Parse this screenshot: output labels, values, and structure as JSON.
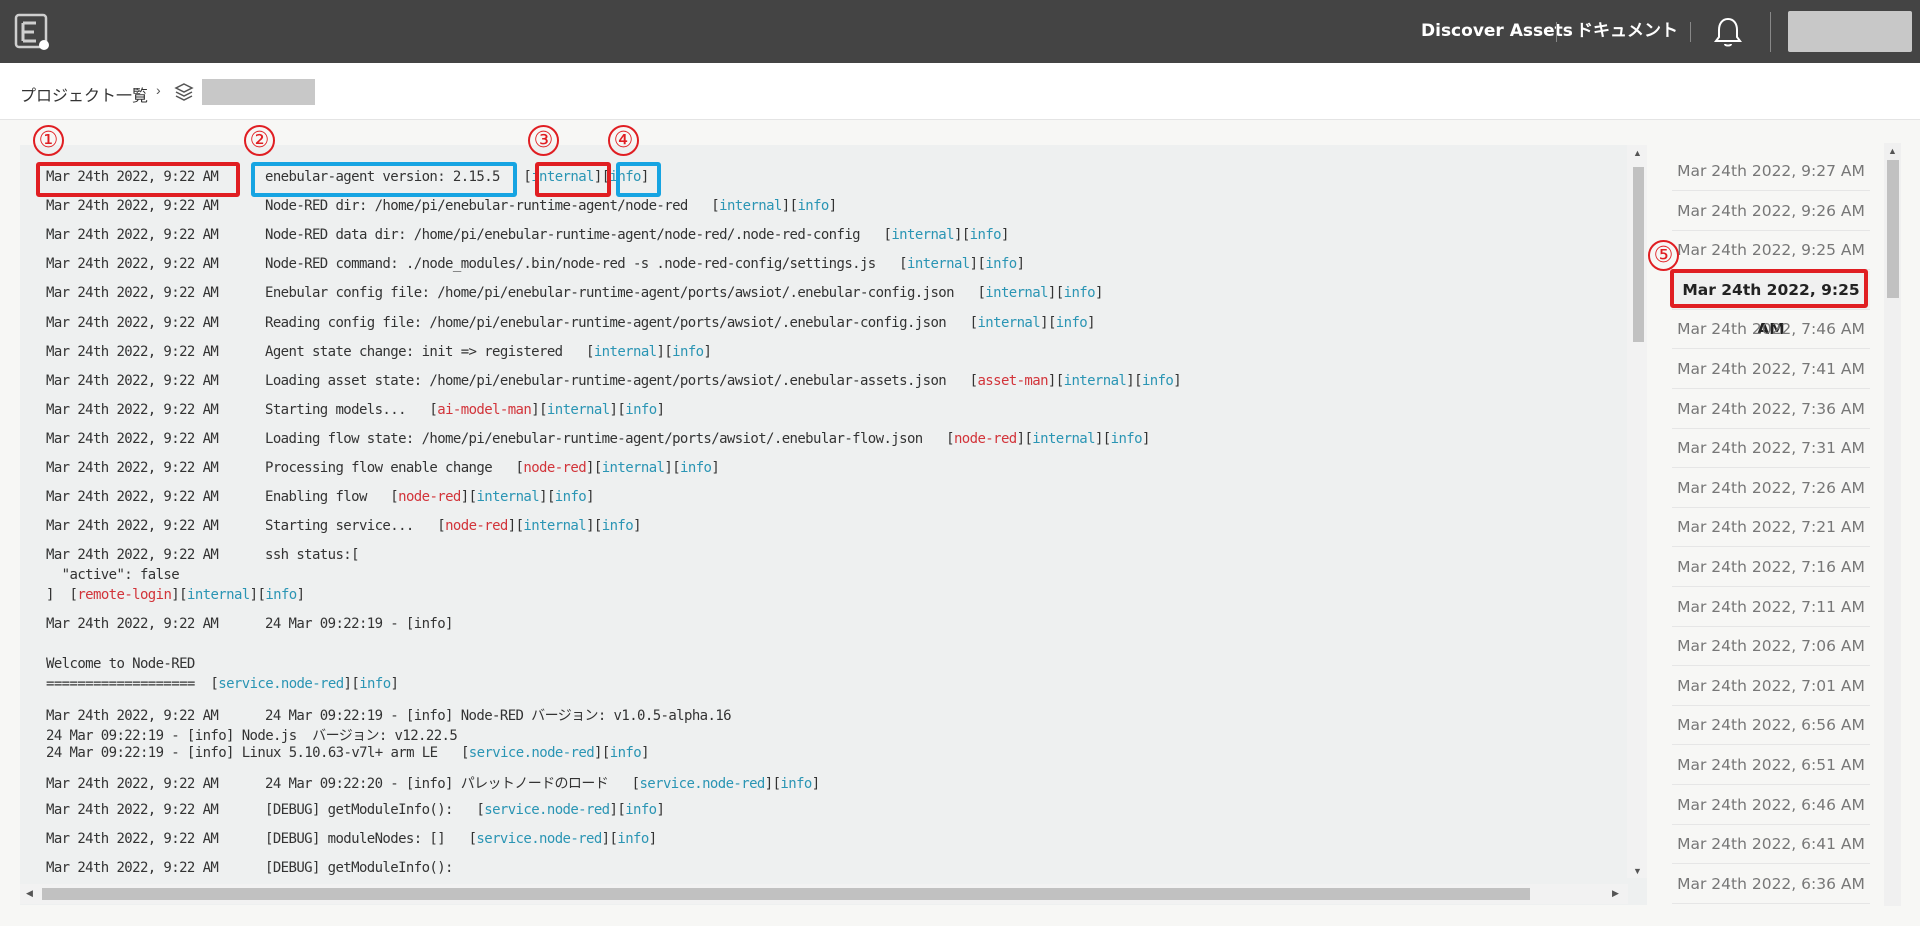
{
  "header": {
    "nav": {
      "discover": "Discover Assets",
      "docs": "ドキュメント"
    }
  },
  "breadcrumb": {
    "projects": "プロジェクト一覧",
    "separator": "›"
  },
  "annotations": [
    "①",
    "②",
    "③",
    "④",
    "⑤"
  ],
  "log_lines": [
    {
      "ts": "Mar 24th 2022, 9:22 AM",
      "msg": "enebular-agent version: 2.15.5",
      "tags": [
        {
          "t": "internal",
          "c": "teal"
        },
        {
          "t": "info",
          "c": "teal"
        }
      ]
    },
    {
      "ts": "Mar 24th 2022, 9:22 AM",
      "msg": "Node-RED dir: /home/pi/enebular-runtime-agent/node-red",
      "tags": [
        {
          "t": "internal",
          "c": "teal"
        },
        {
          "t": "info",
          "c": "teal"
        }
      ]
    },
    {
      "ts": "Mar 24th 2022, 9:22 AM",
      "msg": "Node-RED data dir: /home/pi/enebular-runtime-agent/node-red/.node-red-config",
      "tags": [
        {
          "t": "internal",
          "c": "teal"
        },
        {
          "t": "info",
          "c": "teal"
        }
      ]
    },
    {
      "ts": "Mar 24th 2022, 9:22 AM",
      "msg": "Node-RED command: ./node_modules/.bin/node-red -s .node-red-config/settings.js",
      "tags": [
        {
          "t": "internal",
          "c": "teal"
        },
        {
          "t": "info",
          "c": "teal"
        }
      ]
    },
    {
      "ts": "Mar 24th 2022, 9:22 AM",
      "msg": "Enebular config file: /home/pi/enebular-runtime-agent/ports/awsiot/.enebular-config.json",
      "tags": [
        {
          "t": "internal",
          "c": "teal"
        },
        {
          "t": "info",
          "c": "teal"
        }
      ]
    },
    {
      "ts": "Mar 24th 2022, 9:22 AM",
      "msg": "Reading config file: /home/pi/enebular-runtime-agent/ports/awsiot/.enebular-config.json",
      "tags": [
        {
          "t": "internal",
          "c": "teal"
        },
        {
          "t": "info",
          "c": "teal"
        }
      ]
    },
    {
      "ts": "Mar 24th 2022, 9:22 AM",
      "msg": "Agent state change: init => registered",
      "tags": [
        {
          "t": "internal",
          "c": "teal"
        },
        {
          "t": "info",
          "c": "teal"
        }
      ]
    },
    {
      "ts": "Mar 24th 2022, 9:22 AM",
      "msg": "Loading asset state: /home/pi/enebular-runtime-agent/ports/awsiot/.enebular-assets.json",
      "tags": [
        {
          "t": "asset-man",
          "c": "red"
        },
        {
          "t": "internal",
          "c": "teal"
        },
        {
          "t": "info",
          "c": "teal"
        }
      ]
    },
    {
      "ts": "Mar 24th 2022, 9:22 AM",
      "msg": "Starting models...",
      "tags": [
        {
          "t": "ai-model-man",
          "c": "red"
        },
        {
          "t": "internal",
          "c": "teal"
        },
        {
          "t": "info",
          "c": "teal"
        }
      ]
    },
    {
      "ts": "Mar 24th 2022, 9:22 AM",
      "msg": "Loading flow state: /home/pi/enebular-runtime-agent/ports/awsiot/.enebular-flow.json",
      "tags": [
        {
          "t": "node-red",
          "c": "red"
        },
        {
          "t": "internal",
          "c": "teal"
        },
        {
          "t": "info",
          "c": "teal"
        }
      ]
    },
    {
      "ts": "Mar 24th 2022, 9:22 AM",
      "msg": "Processing flow enable change",
      "tags": [
        {
          "t": "node-red",
          "c": "red"
        },
        {
          "t": "internal",
          "c": "teal"
        },
        {
          "t": "info",
          "c": "teal"
        }
      ]
    },
    {
      "ts": "Mar 24th 2022, 9:22 AM",
      "msg": "Enabling flow",
      "tags": [
        {
          "t": "node-red",
          "c": "red"
        },
        {
          "t": "internal",
          "c": "teal"
        },
        {
          "t": "info",
          "c": "teal"
        }
      ]
    },
    {
      "ts": "Mar 24th 2022, 9:22 AM",
      "msg": "Starting service...",
      "tags": [
        {
          "t": "node-red",
          "c": "red"
        },
        {
          "t": "internal",
          "c": "teal"
        },
        {
          "t": "info",
          "c": "teal"
        }
      ]
    }
  ],
  "ssh_block": {
    "ts": "Mar 24th 2022, 9:22 AM",
    "line1": "ssh status:[",
    "line2": "  \"active\": false",
    "line3": "]  ",
    "tags": [
      {
        "t": "remote-login",
        "c": "red"
      },
      {
        "t": "internal",
        "c": "teal"
      },
      {
        "t": "info",
        "c": "teal"
      }
    ]
  },
  "nodered_start": {
    "ts": "Mar 24th 2022, 9:22 AM",
    "msg": "24 Mar 09:22:19 - [info]"
  },
  "welcome": {
    "line1": "Welcome to Node-RED",
    "line2": "===================",
    "tags": [
      {
        "t": "service.node-red",
        "c": "teal"
      },
      {
        "t": "info",
        "c": "teal"
      }
    ]
  },
  "version_block": {
    "ts": "Mar 24th 2022, 9:22 AM",
    "line1": "24 Mar 09:22:19 - [info] Node-RED バージョン: v1.0.5-alpha.16",
    "line2": "24 Mar 09:22:19 - [info] Node.js  バージョン: v12.22.5",
    "line3": "24 Mar 09:22:19 - [info] Linux 5.10.63-v7l+ arm LE",
    "tags": [
      {
        "t": "service.node-red",
        "c": "teal"
      },
      {
        "t": "info",
        "c": "teal"
      }
    ]
  },
  "tail_lines": [
    {
      "ts": "Mar 24th 2022, 9:22 AM",
      "msg": "24 Mar 09:22:20 - [info] パレットノードのロード",
      "tags": [
        {
          "t": "service.node-red",
          "c": "teal"
        },
        {
          "t": "info",
          "c": "teal"
        }
      ]
    },
    {
      "ts": "Mar 24th 2022, 9:22 AM",
      "msg": "[DEBUG] getModuleInfo():",
      "tags": [
        {
          "t": "service.node-red",
          "c": "teal"
        },
        {
          "t": "info",
          "c": "teal"
        }
      ]
    },
    {
      "ts": "Mar 24th 2022, 9:22 AM",
      "msg": "[DEBUG] moduleNodes: []",
      "tags": [
        {
          "t": "service.node-red",
          "c": "teal"
        },
        {
          "t": "info",
          "c": "teal"
        }
      ]
    },
    {
      "ts": "Mar 24th 2022, 9:22 AM",
      "msg": "[DEBUG] getModuleInfo():",
      "tags": []
    }
  ],
  "sidebar": {
    "selected_index": 3,
    "items": [
      "Mar 24th 2022, 9:27 AM",
      "Mar 24th 2022, 9:26 AM",
      "Mar 24th 2022, 9:25 AM",
      "Mar 24th 2022, 9:25 AM",
      "Mar 24th 2022, 7:46 AM",
      "Mar 24th 2022, 7:41 AM",
      "Mar 24th 2022, 7:36 AM",
      "Mar 24th 2022, 7:31 AM",
      "Mar 24th 2022, 7:26 AM",
      "Mar 24th 2022, 7:21 AM",
      "Mar 24th 2022, 7:16 AM",
      "Mar 24th 2022, 7:11 AM",
      "Mar 24th 2022, 7:06 AM",
      "Mar 24th 2022, 7:01 AM",
      "Mar 24th 2022, 6:56 AM",
      "Mar 24th 2022, 6:51 AM",
      "Mar 24th 2022, 6:46 AM",
      "Mar 24th 2022, 6:41 AM",
      "Mar 24th 2022, 6:36 AM"
    ]
  },
  "colors": {
    "topbar": "#444444",
    "tag_teal": "#2a95b4",
    "tag_red": "#d2343a",
    "annotation_red": "#e01e22",
    "annotation_blue": "#16a4e2"
  }
}
